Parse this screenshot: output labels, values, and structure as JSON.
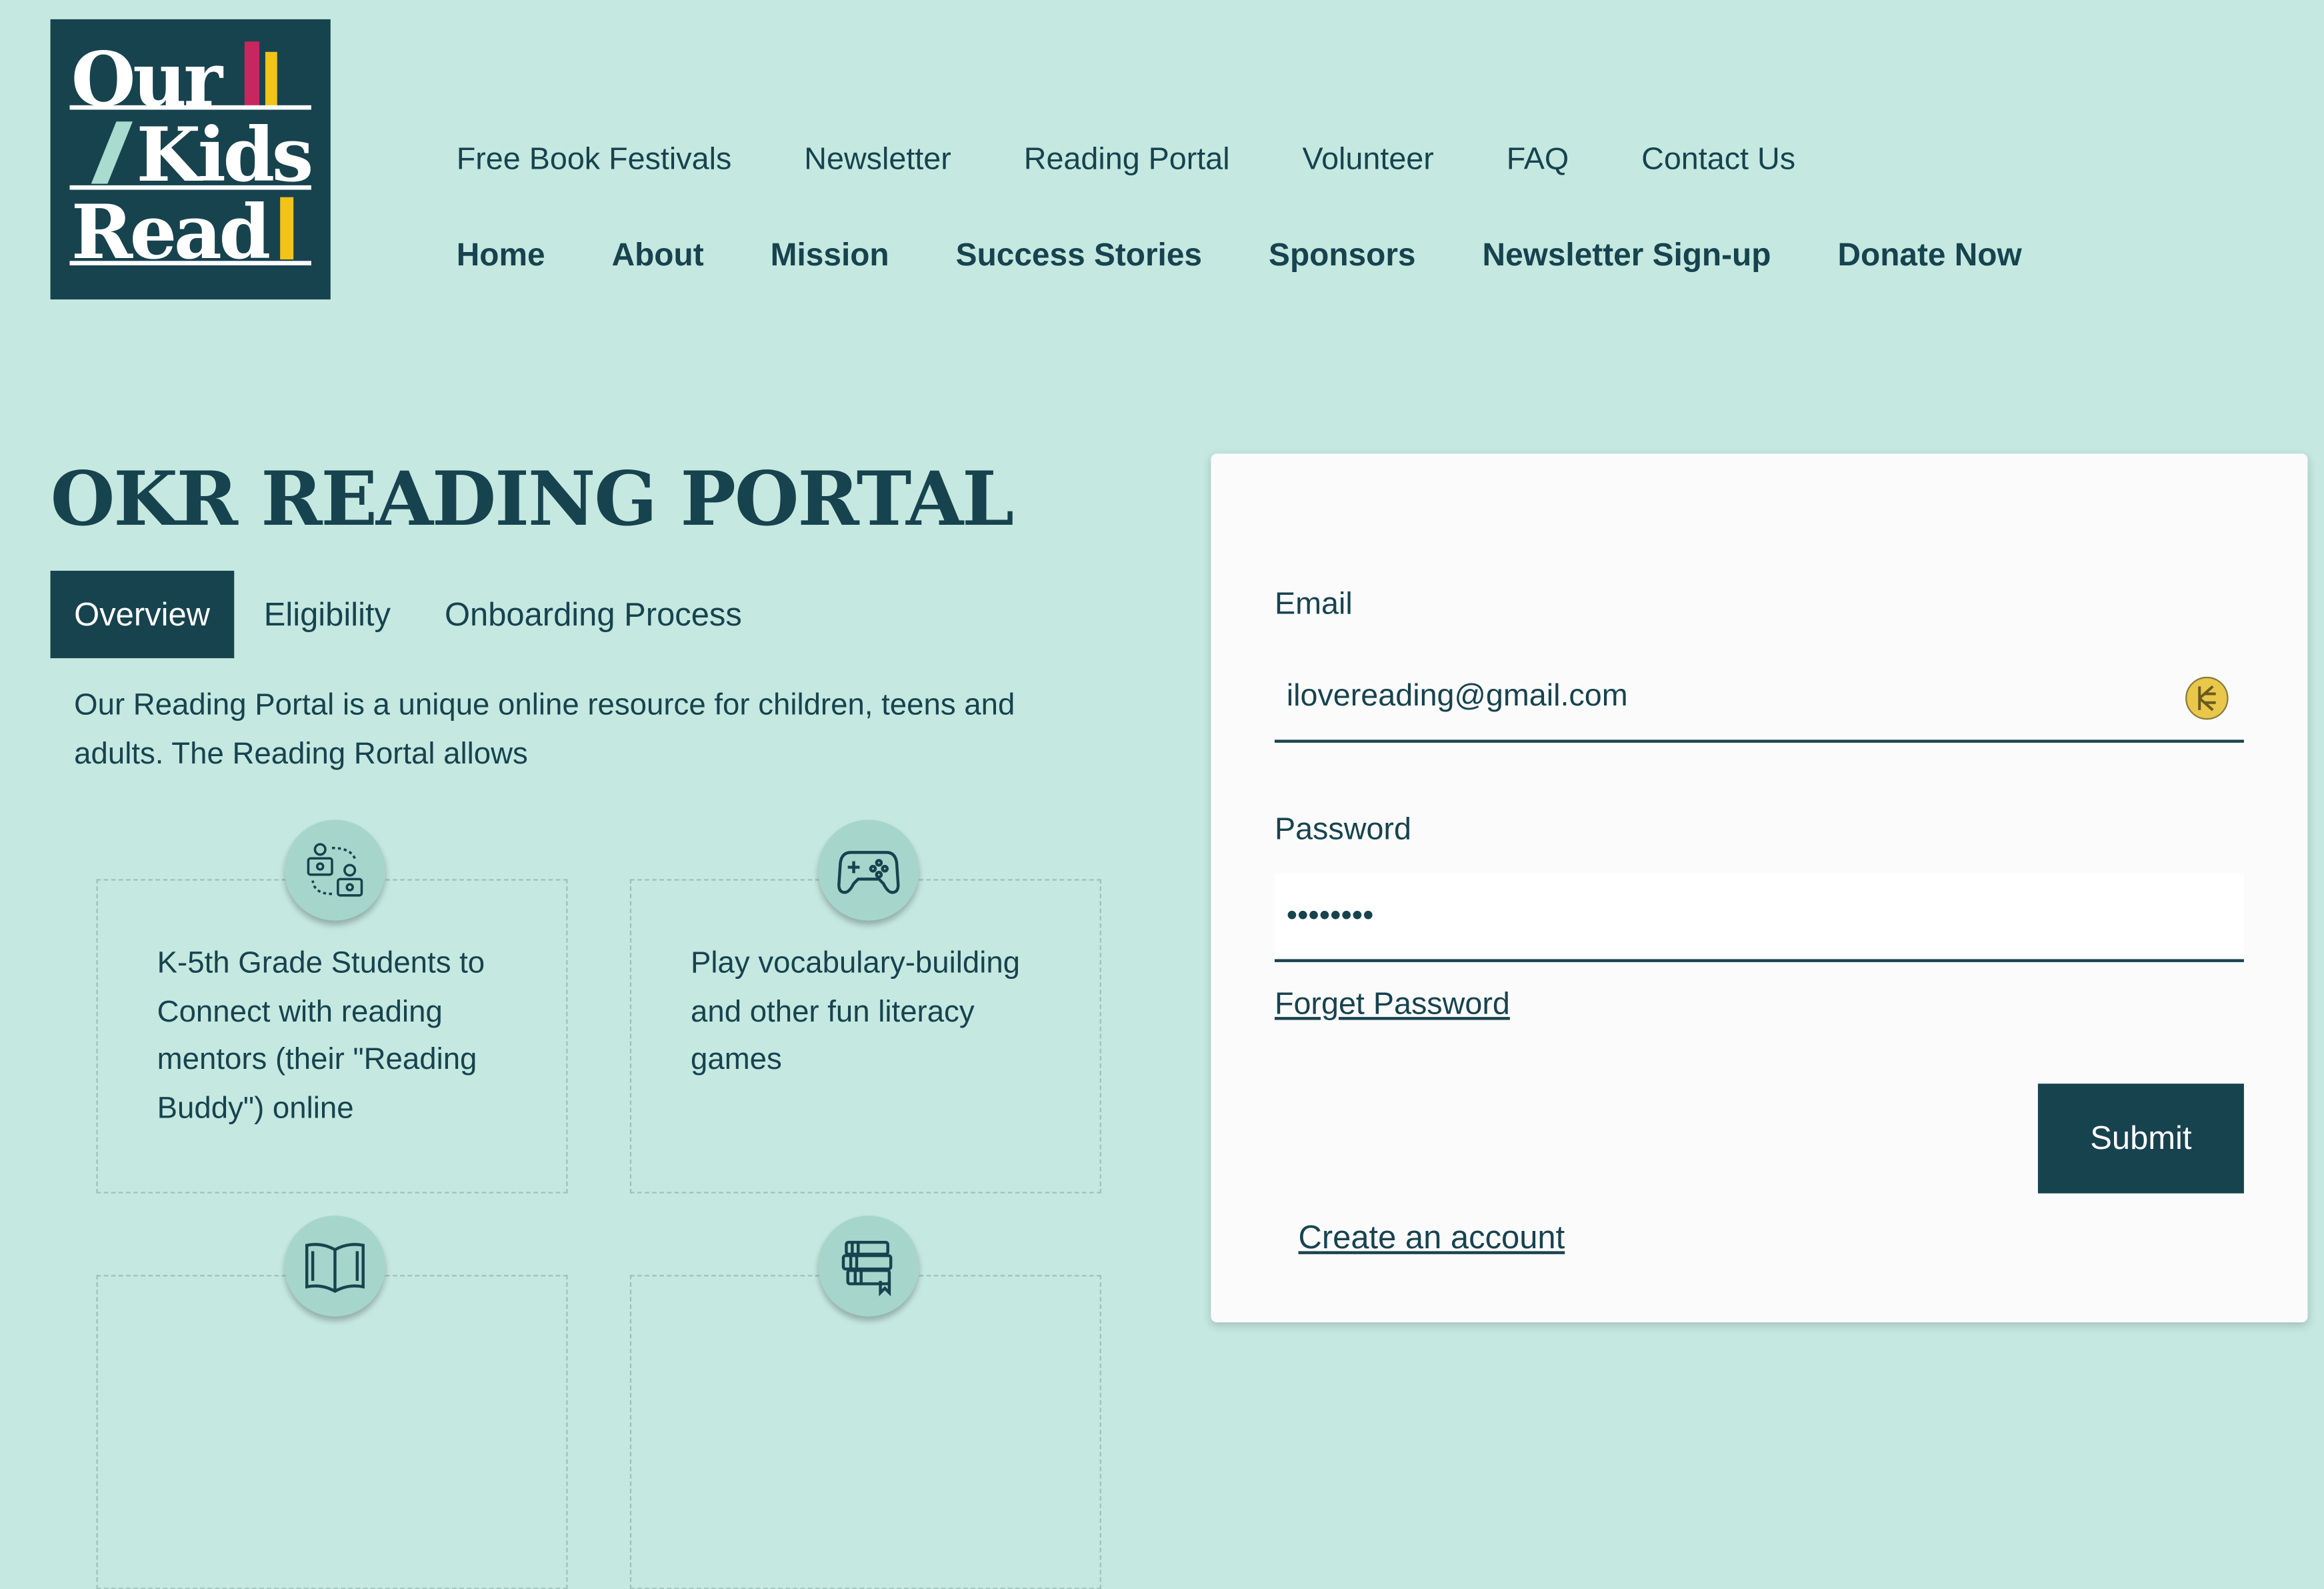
{
  "logo": {
    "line1": "Our",
    "line2": "Kids",
    "line3": "Read"
  },
  "nav_top": [
    "Free Book Festivals",
    "Newsletter",
    "Reading Portal",
    "Volunteer",
    "FAQ",
    "Contact Us"
  ],
  "nav_main": [
    "Home",
    "About",
    "Mission",
    "Success Stories",
    "Sponsors",
    "Newsletter Sign-up",
    "Donate Now"
  ],
  "page_title": "OKR READING PORTAL",
  "tabs": [
    {
      "label": "Overview",
      "active": true
    },
    {
      "label": "Eligibility",
      "active": false
    },
    {
      "label": "Onboarding Process",
      "active": false
    }
  ],
  "intro": "Our Reading Portal is a unique online resource for children, teens and adults. The Reading Rortal allows",
  "features": [
    {
      "icon": "mentor-connection-icon",
      "text": "K-5th Grade Students to Connect with reading mentors (their \"Reading Buddy\") online"
    },
    {
      "icon": "game-controller-icon",
      "text": "Play vocabulary-building and other fun literacy games"
    },
    {
      "icon": "open-book-icon",
      "text": ""
    },
    {
      "icon": "books-stack-icon",
      "text": ""
    }
  ],
  "login": {
    "email_label": "Email",
    "email_value": "ilovereading@gmail.com",
    "password_label": "Password",
    "password_value": "••••••••",
    "forgot_label": "Forget Password",
    "submit_label": "Submit",
    "create_label": "Create an account"
  },
  "colors": {
    "background": "#c5e8e0",
    "primary": "#17434f",
    "panel": "#fbfbfb",
    "icon_circle": "#a6d6cb",
    "logo_accent_pink": "#c8265f",
    "logo_accent_yellow": "#f2c318"
  }
}
